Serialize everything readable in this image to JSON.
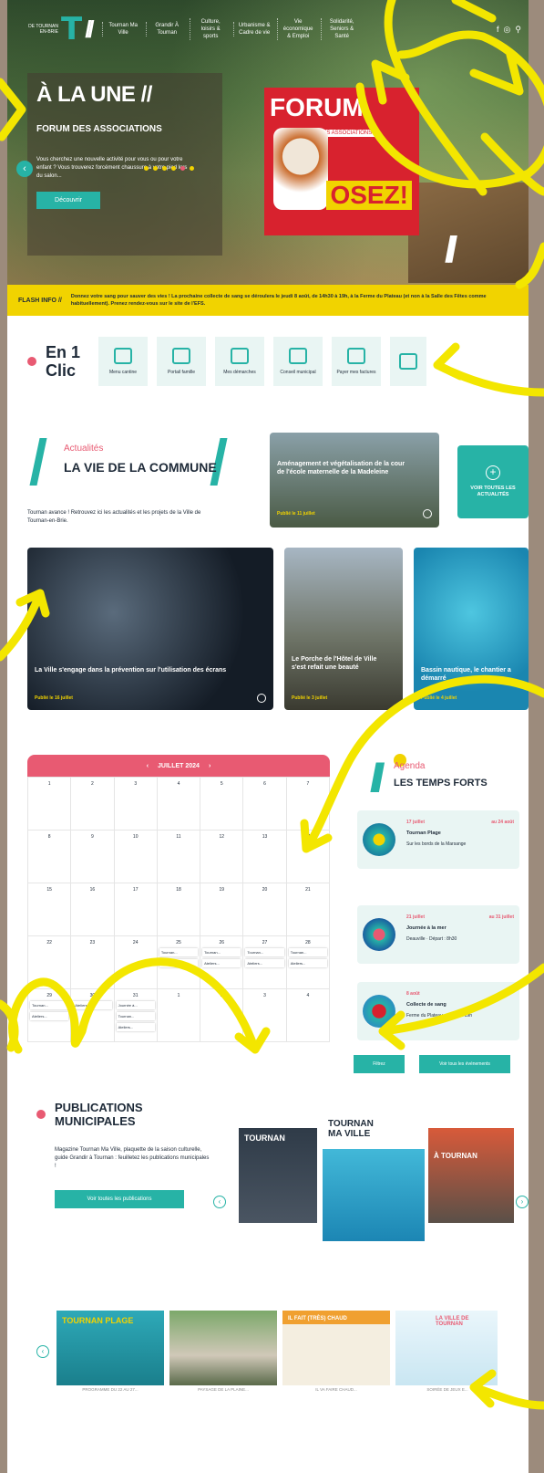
{
  "header": {
    "logo_small": "DE TOURNAN EN-BRIE",
    "nav": [
      "Tournan Ma Ville",
      "Grandir À Tournan",
      "Culture, loisirs & sports",
      "Urbanisme & Cadre de vie",
      "Vie économique & Emploi",
      "Solidarité, Seniors & Santé"
    ],
    "icons": [
      "facebook-icon",
      "instagram-icon",
      "search-icon"
    ]
  },
  "hero": {
    "title": "À LA UNE //",
    "subtitle": "FORUM DES ASSOCIATIONS",
    "text": "Vous cherchez une nouvelle activité pour vous ou pour votre enfant ? Vous trouverez forcément chaussure à votre pied lors du salon...",
    "button": "Découvrir",
    "poster_title": "FORUM",
    "poster_sub": "DES ASSOCIATIONS",
    "poster_osez": "OSEZ!"
  },
  "flash": {
    "label": "FLASH INFO //",
    "text": "Donnez votre sang pour sauver des vies ! La prochaine collecte de sang se déroulera le jeudi 8 août, de 14h30 à 19h, à la Ferme du Plateau (et non à la Salle des Fêtes comme habituellement). Prenez rendez-vous sur le site de l'EFS."
  },
  "en1clic": {
    "title": "En 1 Clic",
    "tiles": [
      "Menu cantine",
      "Portail famille",
      "Mes démarches",
      "Conseil municipal",
      "Payer mes factures"
    ]
  },
  "actualites": {
    "kicker": "Actualités",
    "title": "LA VIE DE LA COMMUNE",
    "text": "Tournan avance ! Retrouvez ici les actualités et les projets de la Ville de Tournan-en-Brie.",
    "see_all": "VOIR TOUTES LES ACTUALITÉS",
    "cards": [
      {
        "title": "Aménagement et végétalisation de la cour de l'école maternelle de la Madeleine",
        "date": "Publié le 11 juillet"
      },
      {
        "title": "La Ville s'engage dans la prévention sur l'utilisation des écrans",
        "date": "Publié le 16 juillet"
      },
      {
        "title": "Le Porche de l'Hôtel de Ville s'est refait une beauté",
        "date": "Publié le 3 juillet"
      },
      {
        "title": "Bassin nautique, le chantier a démarré",
        "date": "Publié le 4 juillet"
      }
    ]
  },
  "agenda": {
    "month": "JUILLET 2024",
    "kicker": "Agenda",
    "title": "LES TEMPS FORTS",
    "days": [
      "1",
      "2",
      "3",
      "4",
      "5",
      "6",
      "7",
      "8",
      "9",
      "10",
      "11",
      "12",
      "13",
      "14",
      "15",
      "16",
      "17",
      "18",
      "19",
      "20",
      "21",
      "22",
      "23",
      "24",
      "25",
      "26",
      "27",
      "28",
      "29",
      "30",
      "31",
      "1",
      "2",
      "3",
      "4"
    ],
    "cell_events": {
      "25": [
        "Tournan...",
        "Ateliers..."
      ],
      "26": [
        "Tournan...",
        "Ateliers..."
      ],
      "27": [
        "Tournan...",
        "Ateliers..."
      ],
      "28": [
        "Tournan...",
        "Ateliers..."
      ],
      "29": [
        "Tournan...",
        "Ateliers..."
      ],
      "30": [
        "Ateliers..."
      ],
      "31": [
        "Journée à...",
        "Tournan...",
        "Ateliers..."
      ]
    },
    "events": [
      {
        "date": "17 juillet",
        "end": "au 24 août",
        "name": "Tournan Plage",
        "place": "Sur les bords de la Marsange"
      },
      {
        "date": "21 juillet",
        "end": "au 31 juillet",
        "name": "Journée à la mer",
        "place": "Deauville · Départ : 8h30"
      },
      {
        "date": "8 août",
        "end": "",
        "name": "Collecte de sang",
        "place": "Ferme du Plateau · 14h30 à 19h"
      }
    ],
    "btn_filter": "Filtrez",
    "btn_all": "Voir tous les événements"
  },
  "publications": {
    "title": "PUBLICATIONS MUNICIPALES",
    "text": "Magazine Tournan Ma Ville, plaquette de la saison culturelle, guide Grandir à Tournan : feuilletez les publications municipales !",
    "button": "Voir toutes les publications",
    "mags": [
      "TOURNAN",
      "TOURNAN MA VILLE",
      "À TOURNAN"
    ]
  },
  "bottom": {
    "captions": [
      "PROGRAMME DU 22 AU 27...",
      "PAYSAGE DE LA PLAINE...",
      "IL VA FAIRE CHAUD...",
      "SOIRÉE DE JEUX E..."
    ],
    "thumb_titles": [
      "TOURNAN PLAGE",
      "",
      "IL FAIT (TRÈS) CHAUD",
      "LA VILLE DE TOURNAN"
    ]
  }
}
